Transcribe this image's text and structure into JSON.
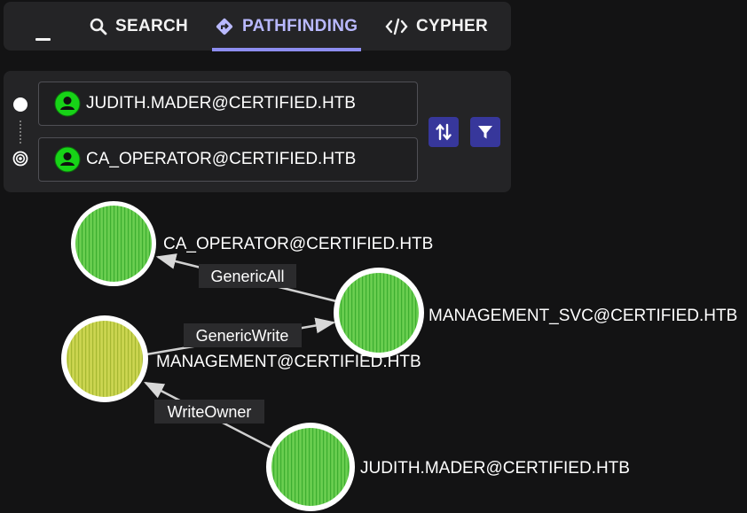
{
  "tabs": {
    "collapse_label": "",
    "search": "SEARCH",
    "pathfinding": "PATHFINDING",
    "cypher": "CYPHER",
    "active": "pathfinding"
  },
  "pathfinding": {
    "source": "JUDITH.MADER@CERTIFIED.HTB",
    "target": "CA_OPERATOR@CERTIFIED.HTB",
    "source_icon": "user-icon",
    "target_icon": "user-icon"
  },
  "graph": {
    "nodes": [
      {
        "id": "ca_operator",
        "label": "CA_OPERATOR@CERTIFIED.HTB",
        "kind": "user",
        "color": "#55c442"
      },
      {
        "id": "management_svc",
        "label": "MANAGEMENT_SVC@CERTIFIED.HTB",
        "kind": "user",
        "color": "#55c442"
      },
      {
        "id": "management",
        "label": "MANAGEMENT@CERTIFIED.HTB",
        "kind": "group",
        "color": "#c2cf45"
      },
      {
        "id": "judith",
        "label": "JUDITH.MADER@CERTIFIED.HTB",
        "kind": "user",
        "color": "#55c442"
      }
    ],
    "edges": [
      {
        "from": "management_svc",
        "to": "ca_operator",
        "label": "GenericAll"
      },
      {
        "from": "management",
        "to": "management_svc",
        "label": "GenericWrite"
      },
      {
        "from": "judith",
        "to": "management",
        "label": "WriteOwner"
      }
    ]
  },
  "colors": {
    "accent": "#8d8df0",
    "button": "#37379b",
    "user_node": "#55c442",
    "group_node": "#c2cf45"
  }
}
